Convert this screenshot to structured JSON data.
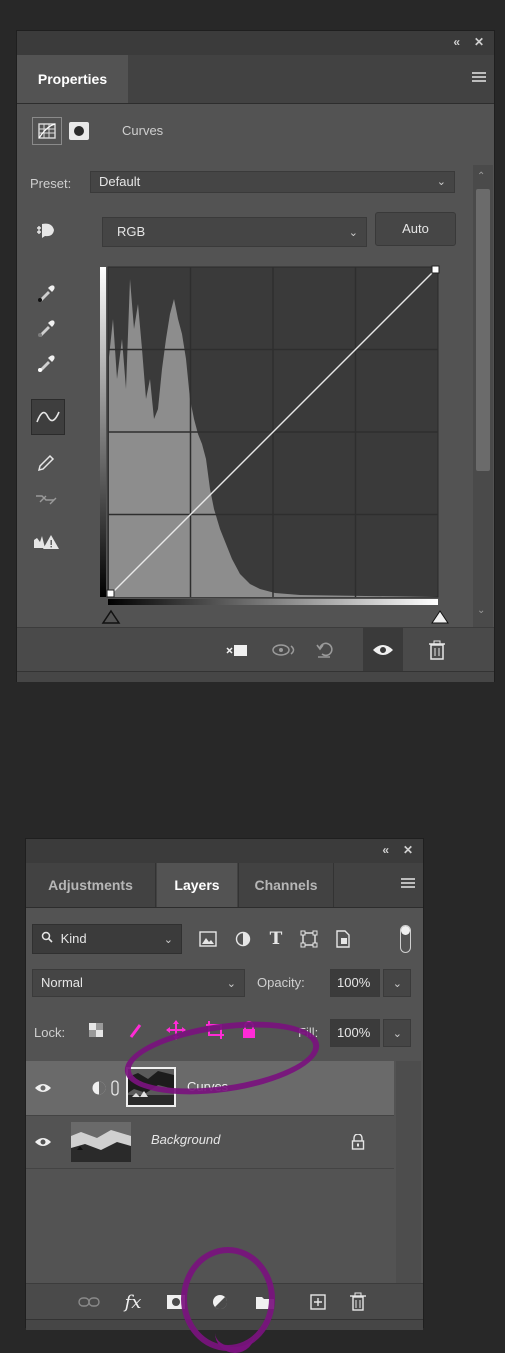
{
  "properties_panel": {
    "tab_label": "Properties",
    "adjustment_name": "Curves",
    "preset_label": "Preset:",
    "preset_value": "Default",
    "channel_value": "RGB",
    "auto_label": "Auto",
    "icons": [
      "adjustment-grid-icon",
      "layer-mask-icon",
      "on-image-adjust-icon",
      "black-point-eyedropper-icon",
      "gray-point-eyedropper-icon",
      "white-point-eyedropper-icon",
      "curve-points-icon",
      "pencil-icon",
      "smooth-icon",
      "clipping-warning-icon",
      "clip-to-layer-icon",
      "view-previous-icon",
      "reset-icon",
      "visibility-icon",
      "delete-icon",
      "collapse-icon",
      "close-icon",
      "panel-menu-icon"
    ]
  },
  "layers_panel": {
    "tabs": [
      "Adjustments",
      "Layers",
      "Channels"
    ],
    "active_tab": "Layers",
    "filter_kind": "Kind",
    "blend_mode": "Normal",
    "opacity_label": "Opacity:",
    "opacity_value": "100%",
    "lock_label": "Lock:",
    "fill_label": "Fill:",
    "fill_value": "100%",
    "layers": [
      {
        "name": "Curves",
        "type": "adjustment",
        "selected": true
      },
      {
        "name": "Background",
        "type": "image",
        "locked": true
      }
    ],
    "bottom_icons": [
      "link-layers-icon",
      "fx-icon",
      "add-mask-icon",
      "new-adjustment-layer-icon",
      "new-group-icon",
      "new-layer-icon",
      "delete-layer-icon"
    ]
  },
  "colors": {
    "panel_bg": "#535353",
    "workspace_bg": "#282828",
    "annotation_purple": "#7a127e",
    "lock_pink": "#ff2bd6"
  }
}
